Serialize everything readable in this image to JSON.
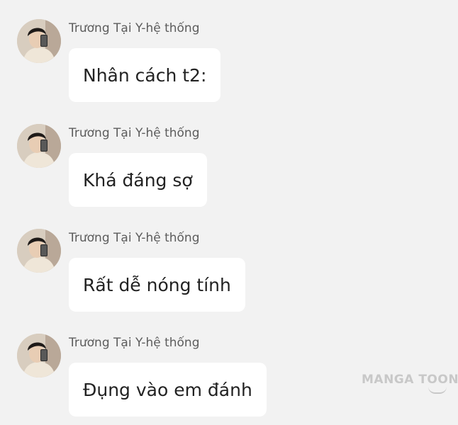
{
  "messages": [
    {
      "sender": "Trương Tại Y-hệ thống",
      "text": "Nhân cách t2:"
    },
    {
      "sender": "Trương Tại Y-hệ thống",
      "text": "Khá đáng sợ"
    },
    {
      "sender": "Trương Tại Y-hệ thống",
      "text": "Rất dễ nóng tính"
    },
    {
      "sender": "Trương Tại Y-hệ thống",
      "text": "Đụng vào em đánh"
    }
  ],
  "watermark": "MANGA TOON",
  "colors": {
    "background": "#f2f2f2",
    "bubble": "#ffffff",
    "sender_text": "#5c5c5c",
    "message_text": "#222222"
  }
}
